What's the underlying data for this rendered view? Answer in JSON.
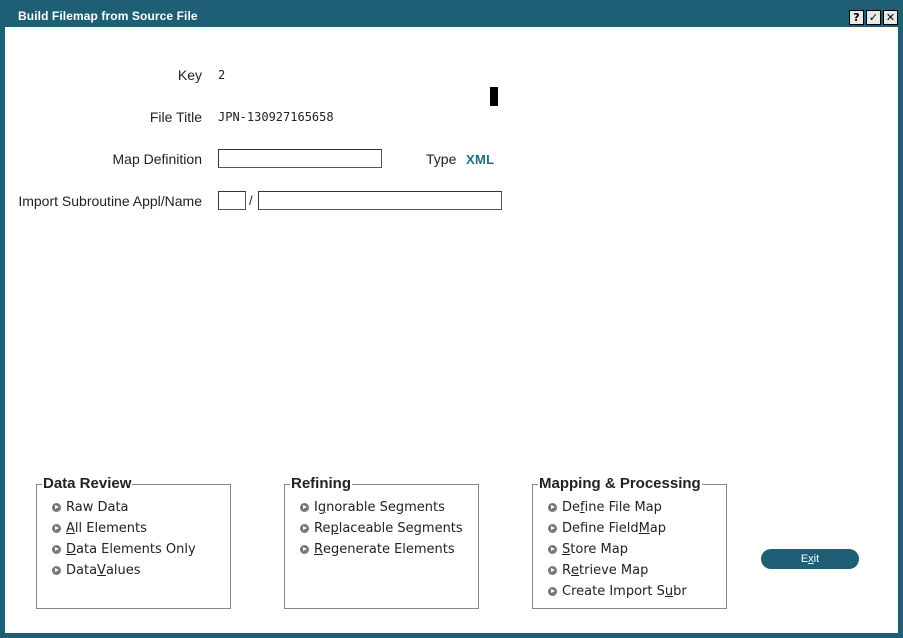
{
  "window": {
    "title": "Build Filemap from Source File",
    "help_btn": "?",
    "ok_btn": "✓",
    "close_btn": "✕"
  },
  "form": {
    "key_label": "Key",
    "key_value": "2",
    "file_title_label": "File Title",
    "file_title_value": "JPN-130927165658",
    "map_definition_label": "Map Definition",
    "map_definition_value": "",
    "type_label": "Type",
    "type_value": "XML",
    "import_label": "Import Subroutine Appl/Name",
    "import_appl_value": "",
    "import_separator": "/",
    "import_name_value": ""
  },
  "groups": {
    "data_review": {
      "title": "Data Review",
      "items": [
        {
          "pre": "Raw Data",
          "ul": "",
          "post": ""
        },
        {
          "pre": "",
          "ul": "A",
          "post": "ll Elements"
        },
        {
          "pre": "",
          "ul": "D",
          "post": "ata Elements Only"
        },
        {
          "pre": "Data ",
          "ul": "V",
          "post": "alues"
        }
      ]
    },
    "refining": {
      "title": "Refining",
      "items": [
        {
          "pre": "I",
          "ul": "g",
          "post": "norable Segments"
        },
        {
          "pre": "Re",
          "ul": "p",
          "post": "laceable Segments"
        },
        {
          "pre": "",
          "ul": "R",
          "post": "egenerate Elements"
        }
      ]
    },
    "mapping": {
      "title": "Mapping & Processing",
      "items": [
        {
          "pre": "De",
          "ul": "f",
          "post": "ine File Map"
        },
        {
          "pre": "Define Field ",
          "ul": "M",
          "post": "ap"
        },
        {
          "pre": "",
          "ul": "S",
          "post": "tore Map"
        },
        {
          "pre": "R",
          "ul": "e",
          "post": "trieve Map"
        },
        {
          "pre": "Create Import S",
          "ul": "u",
          "post": "br"
        }
      ]
    }
  },
  "exit_button": {
    "pre": "E",
    "ul": "x",
    "post": "it"
  }
}
